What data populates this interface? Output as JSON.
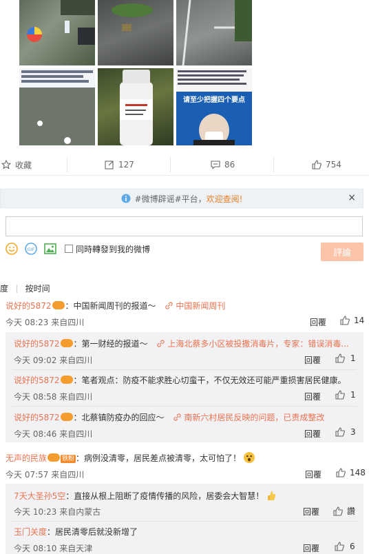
{
  "images": [
    {
      "name": "street-umbrella-photo"
    },
    {
      "name": "wet-pavement-photo"
    },
    {
      "name": "parking-lot-photo"
    },
    {
      "name": "weibo-post-screenshot"
    },
    {
      "name": "medicine-bottle-photo"
    },
    {
      "name": "press-conference-photo",
      "banner": "请至少把握四个要点"
    }
  ],
  "actions": {
    "favorite": "收藏",
    "repost": "127",
    "comment": "86",
    "like": "754"
  },
  "notice": {
    "prefix": "#微博辟谣#平台，",
    "link": "欢迎查阅!",
    "close": "×"
  },
  "compose": {
    "sync_label": "同時轉發到我的微博",
    "submit": "評論"
  },
  "sort": {
    "hot": "度",
    "time": "按时间"
  },
  "comments": [
    {
      "user": "说好的5872",
      "text": "：中国新闻周刊的报道～",
      "ref": "中国新闻周刊",
      "time": "今天 08:23 来自四川",
      "reply": "回覆",
      "likes": "14"
    },
    {
      "user": "说好的5872",
      "text": "：第一财经的报道～",
      "ref": "上海北蔡多小区被投撒消毒片，专家：错误消毒...",
      "time": "今天 09:02 来自四川",
      "reply": "回覆",
      "likes": "1"
    },
    {
      "user": "说好的5872",
      "text": "：笔者观点：防疫不能求胜心切蛮干，不仅无效还可能严重损害居民健康。",
      "time": "今天 08:58 来自四川",
      "reply": "回覆",
      "likes": "1"
    },
    {
      "user": "说好的5872",
      "text": "：北蔡镇防疫办的回应～",
      "ref": "南新六村居民反映的问题，已责成整改",
      "time": "今天 08:46 来自四川",
      "reply": "回覆",
      "likes": "3"
    },
    {
      "user": "无声的民族",
      "badge": "铁粉",
      "text": "：病例没清零，居民差点被清零，太可怕了！",
      "time": "今天 07:57 来自四川",
      "reply": "回覆",
      "likes": "148"
    },
    {
      "user": "7天大圣孙5空",
      "text": "：直接从根上阻断了疫情传播的风险，居委会大智慧！",
      "time": "今天 10:23 来自内蒙古",
      "reply": "回覆",
      "likes": "讚"
    },
    {
      "user": "玉门关度",
      "text": "：居民清零后就没新增了",
      "time": "今天 08:10 来自天津",
      "reply": "回覆",
      "likes": "6"
    }
  ]
}
